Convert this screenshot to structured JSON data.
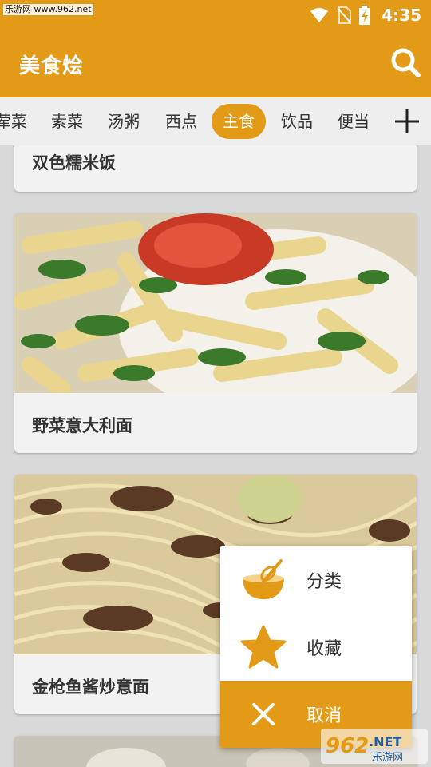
{
  "status_bar": {
    "watermark": "乐游网 www.962.net",
    "time": "4:35"
  },
  "app_bar": {
    "title": "美食烩"
  },
  "tabs": [
    {
      "label": "荤菜"
    },
    {
      "label": "素菜"
    },
    {
      "label": "汤粥"
    },
    {
      "label": "西点"
    },
    {
      "label": "主食",
      "active": true
    },
    {
      "label": "饮品"
    },
    {
      "label": "便当"
    }
  ],
  "cards": [
    {
      "title": "双色糯米饭"
    },
    {
      "title": "野菜意大利面"
    },
    {
      "title": "金枪鱼酱炒意面"
    }
  ],
  "menu": {
    "category": "分类",
    "favorite": "收藏",
    "cancel": "取消"
  },
  "watermark_logo": {
    "number": "962",
    "suffix": ".NET",
    "site": "乐游网"
  },
  "colors": {
    "accent": "#e39a16",
    "card_bg": "#f2f2f2",
    "page_bg": "#d9d9d9"
  },
  "icons": [
    "wifi-icon",
    "no-sim-icon",
    "battery-charging-icon",
    "search-icon",
    "add-icon",
    "whisk-bowl-icon",
    "star-icon",
    "close-icon"
  ]
}
